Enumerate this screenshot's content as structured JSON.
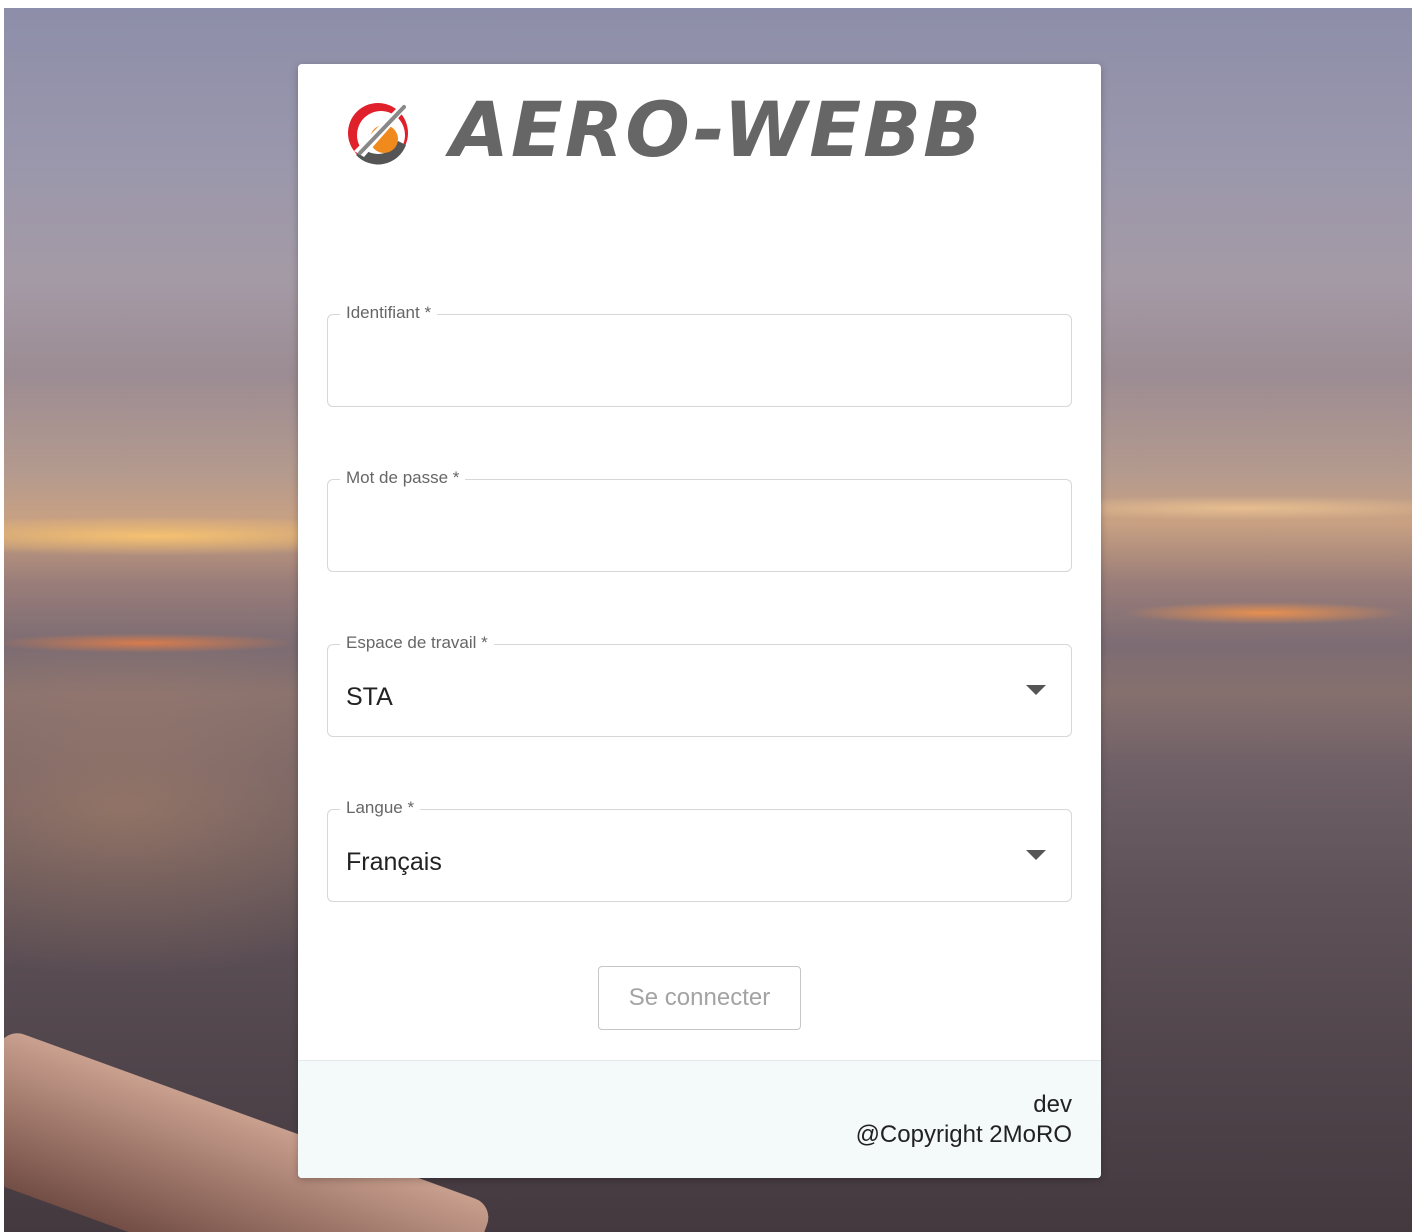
{
  "brand": {
    "name": "AERO-WEBB",
    "logo_icon": "aero-webb-logo-icon",
    "colors": {
      "red": "#e0202a",
      "orange": "#f08a1c",
      "gray": "#666666"
    }
  },
  "form": {
    "username": {
      "label": "Identifiant *",
      "value": ""
    },
    "password": {
      "label": "Mot de passe *",
      "value": ""
    },
    "workspace": {
      "label": "Espace de travail *",
      "value": "STA"
    },
    "language": {
      "label": "Langue *",
      "value": "Français"
    },
    "submit_label": "Se connecter"
  },
  "footer": {
    "environment": "dev",
    "copyright": "@Copyright 2MoRO"
  }
}
